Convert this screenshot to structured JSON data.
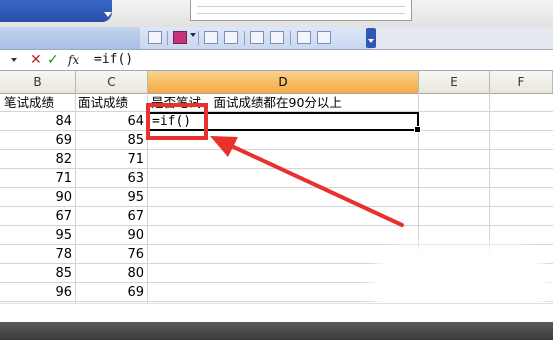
{
  "formula_bar": {
    "cancel_symbol": "✕",
    "enter_symbol": "✓",
    "fx_label": "fx",
    "value": "=if()"
  },
  "columns": [
    "B",
    "C",
    "D",
    "E",
    "F"
  ],
  "active_column": "D",
  "sheet": {
    "header": {
      "b": "笔试成绩",
      "c": "面试成绩",
      "d": "是否笔试、面试成绩都在90分以上"
    },
    "rows": [
      {
        "b": "84",
        "c": "64",
        "d": "=if()"
      },
      {
        "b": "69",
        "c": "85",
        "d": ""
      },
      {
        "b": "82",
        "c": "71",
        "d": ""
      },
      {
        "b": "71",
        "c": "63",
        "d": ""
      },
      {
        "b": "90",
        "c": "95",
        "d": ""
      },
      {
        "b": "67",
        "c": "67",
        "d": ""
      },
      {
        "b": "95",
        "c": "90",
        "d": ""
      },
      {
        "b": "78",
        "c": "76",
        "d": ""
      },
      {
        "b": "85",
        "c": "80",
        "d": ""
      },
      {
        "b": "96",
        "c": "69",
        "d": ""
      }
    ]
  },
  "colors": {
    "annotation": "#e8302c",
    "active_header": "#f5a941",
    "toolbar_blue": "#2a4fa8"
  }
}
